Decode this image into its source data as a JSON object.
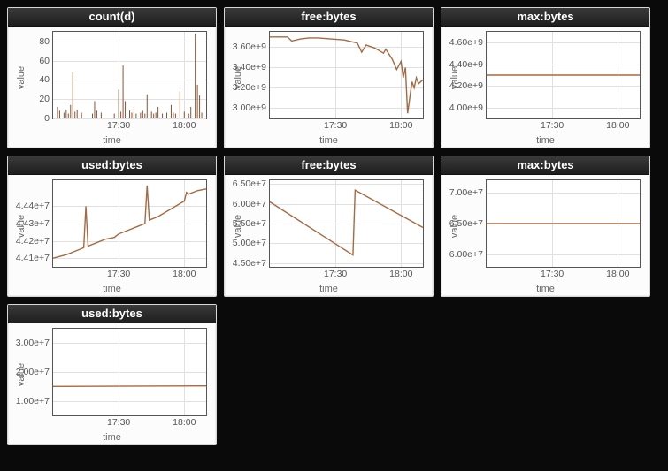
{
  "chart_data": [
    {
      "id": "countd",
      "title": "count(d)",
      "type": "bar",
      "xlabel": "time",
      "ylabel": "value",
      "yticks": [
        0,
        20,
        40,
        60,
        80
      ],
      "xticks_labels": [
        "17:30",
        "18:00"
      ],
      "xticks_values": [
        30,
        60
      ],
      "xlim": [
        0,
        70
      ],
      "ylim": [
        0,
        90
      ],
      "series": [
        {
          "name": "count",
          "x": [
            2,
            3,
            5,
            6,
            7,
            8,
            9,
            10,
            11,
            13,
            18,
            19,
            20,
            22,
            28,
            30,
            31,
            32,
            33,
            35,
            36,
            37,
            38,
            40,
            41,
            42,
            43,
            45,
            46,
            47,
            48,
            50,
            52,
            54,
            55,
            56,
            58,
            60,
            62,
            63,
            65,
            66,
            67,
            68
          ],
          "y": [
            12,
            8,
            6,
            9,
            5,
            14,
            48,
            7,
            9,
            6,
            5,
            18,
            8,
            6,
            5,
            30,
            7,
            55,
            18,
            8,
            6,
            12,
            5,
            6,
            8,
            5,
            25,
            7,
            5,
            6,
            12,
            5,
            6,
            14,
            6,
            5,
            28,
            7,
            5,
            12,
            88,
            35,
            24,
            6
          ]
        }
      ]
    },
    {
      "id": "free1",
      "title": "free:bytes",
      "type": "line",
      "xlabel": "time",
      "ylabel": "value",
      "yticks": [
        3000000000.0,
        3200000000.0,
        3400000000.0,
        3600000000.0
      ],
      "ytick_labels": [
        "3.00e+9",
        "3.20e+9",
        "3.40e+9",
        "3.60e+9"
      ],
      "xticks_labels": [
        "17:30",
        "18:00"
      ],
      "xticks_values": [
        30,
        60
      ],
      "xlim": [
        0,
        70
      ],
      "ylim": [
        2900000000.0,
        3750000000.0
      ],
      "series": [
        {
          "name": "free",
          "x": [
            0,
            8,
            10,
            14,
            18,
            22,
            28,
            34,
            40,
            42,
            44,
            48,
            52,
            53,
            56,
            58,
            60,
            61,
            62,
            63,
            65,
            66,
            67,
            68,
            70
          ],
          "y": [
            3700000000.0,
            3700000000.0,
            3660000000.0,
            3680000000.0,
            3690000000.0,
            3690000000.0,
            3680000000.0,
            3670000000.0,
            3640000000.0,
            3550000000.0,
            3620000000.0,
            3590000000.0,
            3540000000.0,
            3580000000.0,
            3480000000.0,
            3380000000.0,
            3460000000.0,
            3300000000.0,
            3400000000.0,
            2950000000.0,
            3260000000.0,
            3200000000.0,
            3300000000.0,
            3240000000.0,
            3280000000.0
          ]
        }
      ]
    },
    {
      "id": "max1",
      "title": "max:bytes",
      "type": "line",
      "xlabel": "time",
      "ylabel": "value",
      "yticks": [
        4000000000.0,
        4200000000.0,
        4400000000.0,
        4600000000.0
      ],
      "ytick_labels": [
        "4.00e+9",
        "4.20e+9",
        "4.40e+9",
        "4.60e+9"
      ],
      "xticks_labels": [
        "17:30",
        "18:00"
      ],
      "xticks_values": [
        30,
        60
      ],
      "xlim": [
        0,
        70
      ],
      "ylim": [
        3900000000.0,
        4700000000.0
      ],
      "series": [
        {
          "name": "max",
          "x": [
            0,
            70
          ],
          "y": [
            4300000000.0,
            4300000000.0
          ]
        }
      ]
    },
    {
      "id": "used1",
      "title": "used:bytes",
      "type": "line",
      "xlabel": "time",
      "ylabel": "value",
      "yticks": [
        44100000.0,
        44200000.0,
        44300000.0,
        44400000.0
      ],
      "ytick_labels": [
        "4.41e+7",
        "4.42e+7",
        "4.43e+7",
        "4.44e+7"
      ],
      "xticks_labels": [
        "17:30",
        "18:00"
      ],
      "xticks_values": [
        30,
        60
      ],
      "xlim": [
        0,
        70
      ],
      "ylim": [
        44050000.0,
        44550000.0
      ],
      "series": [
        {
          "name": "used",
          "x": [
            0,
            6,
            10,
            12,
            14,
            15,
            16,
            20,
            24,
            28,
            29,
            30,
            34,
            38,
            42,
            43,
            44,
            48,
            52,
            56,
            60,
            61,
            62,
            66,
            70
          ],
          "y": [
            44100000.0,
            44120000.0,
            44140000.0,
            44150000.0,
            44160000.0,
            44400000.0,
            44170000.0,
            44190000.0,
            44210000.0,
            44220000.0,
            44230000.0,
            44240000.0,
            44260000.0,
            44280000.0,
            44300000.0,
            44520000.0,
            44320000.0,
            44340000.0,
            44370000.0,
            44400000.0,
            44430000.0,
            44480000.0,
            44470000.0,
            44490000.0,
            44500000.0
          ]
        }
      ]
    },
    {
      "id": "free2",
      "title": "free:bytes",
      "type": "line",
      "xlabel": "time",
      "ylabel": "value",
      "yticks": [
        45000000.0,
        50000000.0,
        55000000.0,
        60000000.0,
        65000000.0
      ],
      "ytick_labels": [
        "4.50e+7",
        "5.00e+7",
        "5.50e+7",
        "6.00e+7",
        "6.50e+7"
      ],
      "xticks_labels": [
        "17:30",
        "18:00"
      ],
      "xticks_values": [
        30,
        60
      ],
      "xlim": [
        0,
        70
      ],
      "ylim": [
        44000000.0,
        66000000.0
      ],
      "series": [
        {
          "name": "free",
          "x": [
            0,
            38,
            39,
            70
          ],
          "y": [
            60500000.0,
            47000000.0,
            63500000.0,
            54000000.0
          ]
        }
      ]
    },
    {
      "id": "max2",
      "title": "max:bytes",
      "type": "line",
      "xlabel": "time",
      "ylabel": "value",
      "yticks": [
        60000000.0,
        65000000.0,
        70000000.0
      ],
      "ytick_labels": [
        "6.00e+7",
        "6.50e+7",
        "7.00e+7"
      ],
      "xticks_labels": [
        "17:30",
        "18:00"
      ],
      "xticks_values": [
        30,
        60
      ],
      "xlim": [
        0,
        70
      ],
      "ylim": [
        58000000.0,
        72000000.0
      ],
      "series": [
        {
          "name": "max",
          "x": [
            0,
            70
          ],
          "y": [
            65000000.0,
            65000000.0
          ]
        }
      ]
    },
    {
      "id": "used2",
      "title": "used:bytes",
      "type": "line",
      "xlabel": "time",
      "ylabel": "value",
      "yticks": [
        10000000.0,
        20000000.0,
        30000000.0
      ],
      "ytick_labels": [
        "1.00e+7",
        "2.00e+7",
        "3.00e+7"
      ],
      "xticks_labels": [
        "17:30",
        "18:00"
      ],
      "xticks_values": [
        30,
        60
      ],
      "xlim": [
        0,
        70
      ],
      "ylim": [
        5000000.0,
        35000000.0
      ],
      "series": [
        {
          "name": "used",
          "x": [
            0,
            70
          ],
          "y": [
            15000000.0,
            15200000.0
          ]
        }
      ]
    }
  ]
}
